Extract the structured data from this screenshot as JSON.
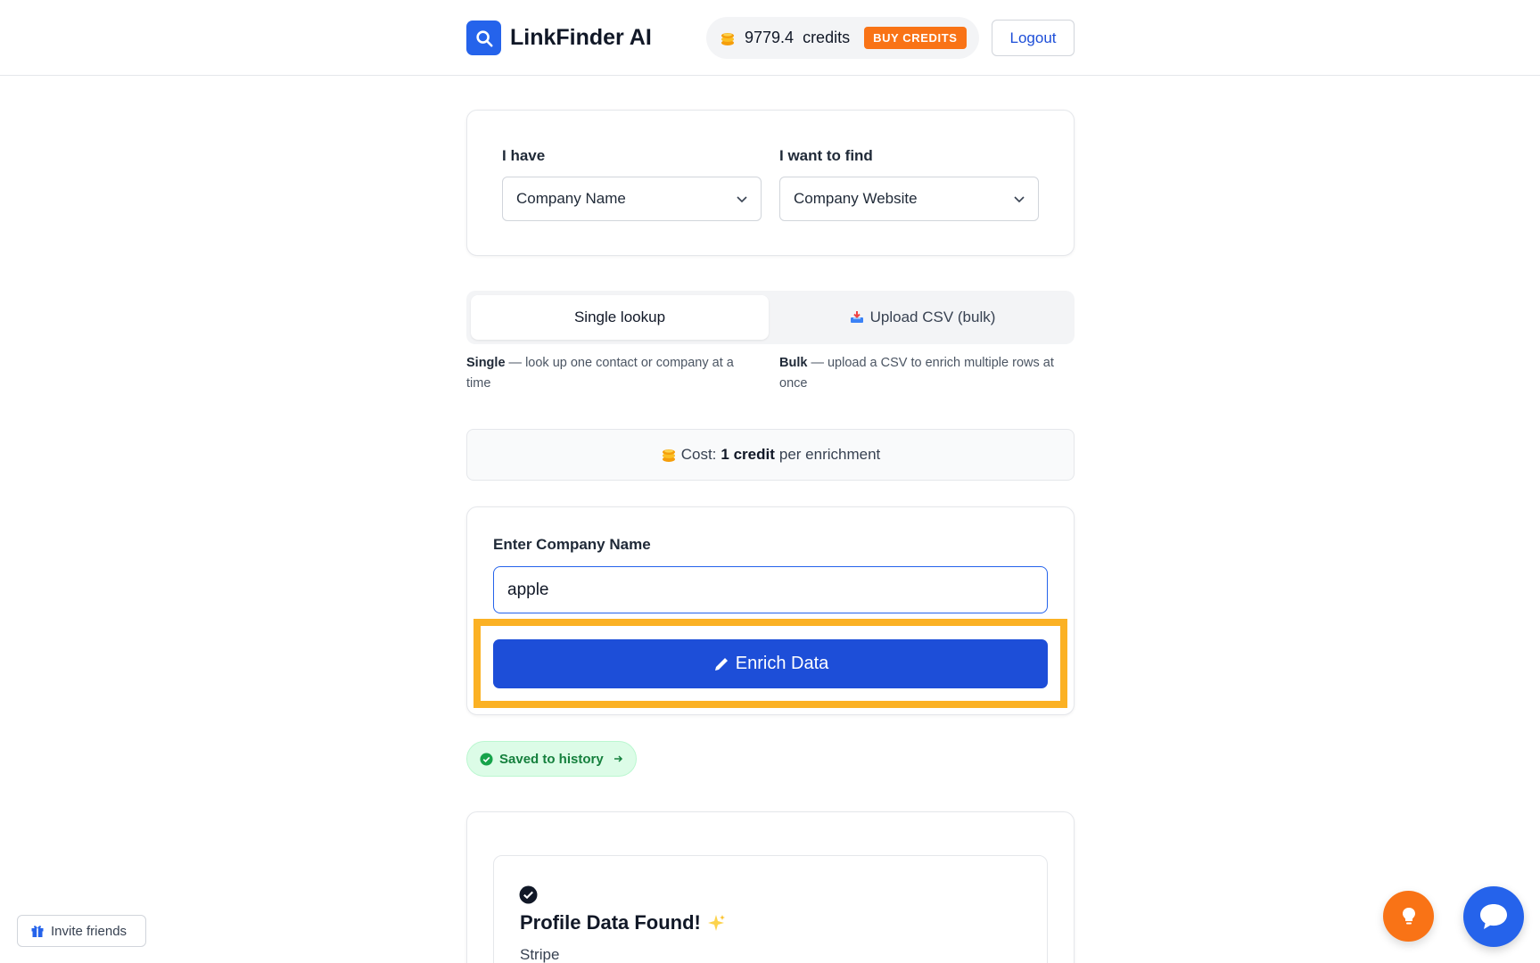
{
  "header": {
    "brand_name": "LinkFinder AI",
    "credits_amount": "9779.4",
    "credits_label": "credits",
    "buy_label": "BUY CREDITS",
    "logout_label": "Logout"
  },
  "selector": {
    "have_label": "I have",
    "have_value": "Company Name",
    "find_label": "I want to find",
    "find_value": "Company Website"
  },
  "mode": {
    "single_label": "Single lookup",
    "bulk_label": "Upload CSV (bulk)",
    "single_desc_bold": "Single",
    "single_desc": " — look up one contact or company at a time",
    "bulk_desc_bold": "Bulk",
    "bulk_desc": " — upload a CSV to enrich multiple rows at once"
  },
  "cost": {
    "prefix": "Cost:",
    "amount": "1 credit",
    "suffix": "per enrichment"
  },
  "form": {
    "input_label": "Enter Company Name",
    "input_value": "apple",
    "button_label": "Enrich Data"
  },
  "saved": {
    "label": "Saved to history"
  },
  "result": {
    "title": "Profile Data Found!",
    "subtitle": "Stripe"
  },
  "footer": {
    "invite_label": "Invite friends"
  },
  "colors": {
    "primary": "#2563eb",
    "button": "#1d4ed8",
    "accent_orange": "#f97316",
    "highlight": "#fbb124",
    "success": "#15803d"
  }
}
